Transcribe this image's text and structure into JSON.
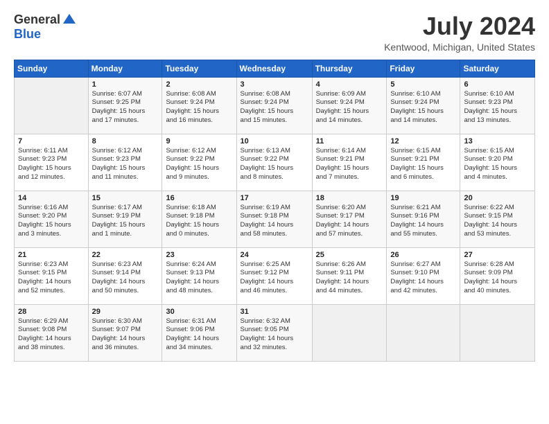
{
  "header": {
    "logo_general": "General",
    "logo_blue": "Blue",
    "month_title": "July 2024",
    "location": "Kentwood, Michigan, United States"
  },
  "weekdays": [
    "Sunday",
    "Monday",
    "Tuesday",
    "Wednesday",
    "Thursday",
    "Friday",
    "Saturday"
  ],
  "weeks": [
    [
      {
        "day": "",
        "info": ""
      },
      {
        "day": "1",
        "info": "Sunrise: 6:07 AM\nSunset: 9:25 PM\nDaylight: 15 hours\nand 17 minutes."
      },
      {
        "day": "2",
        "info": "Sunrise: 6:08 AM\nSunset: 9:24 PM\nDaylight: 15 hours\nand 16 minutes."
      },
      {
        "day": "3",
        "info": "Sunrise: 6:08 AM\nSunset: 9:24 PM\nDaylight: 15 hours\nand 15 minutes."
      },
      {
        "day": "4",
        "info": "Sunrise: 6:09 AM\nSunset: 9:24 PM\nDaylight: 15 hours\nand 14 minutes."
      },
      {
        "day": "5",
        "info": "Sunrise: 6:10 AM\nSunset: 9:24 PM\nDaylight: 15 hours\nand 14 minutes."
      },
      {
        "day": "6",
        "info": "Sunrise: 6:10 AM\nSunset: 9:23 PM\nDaylight: 15 hours\nand 13 minutes."
      }
    ],
    [
      {
        "day": "7",
        "info": "Sunrise: 6:11 AM\nSunset: 9:23 PM\nDaylight: 15 hours\nand 12 minutes."
      },
      {
        "day": "8",
        "info": "Sunrise: 6:12 AM\nSunset: 9:23 PM\nDaylight: 15 hours\nand 11 minutes."
      },
      {
        "day": "9",
        "info": "Sunrise: 6:12 AM\nSunset: 9:22 PM\nDaylight: 15 hours\nand 9 minutes."
      },
      {
        "day": "10",
        "info": "Sunrise: 6:13 AM\nSunset: 9:22 PM\nDaylight: 15 hours\nand 8 minutes."
      },
      {
        "day": "11",
        "info": "Sunrise: 6:14 AM\nSunset: 9:21 PM\nDaylight: 15 hours\nand 7 minutes."
      },
      {
        "day": "12",
        "info": "Sunrise: 6:15 AM\nSunset: 9:21 PM\nDaylight: 15 hours\nand 6 minutes."
      },
      {
        "day": "13",
        "info": "Sunrise: 6:15 AM\nSunset: 9:20 PM\nDaylight: 15 hours\nand 4 minutes."
      }
    ],
    [
      {
        "day": "14",
        "info": "Sunrise: 6:16 AM\nSunset: 9:20 PM\nDaylight: 15 hours\nand 3 minutes."
      },
      {
        "day": "15",
        "info": "Sunrise: 6:17 AM\nSunset: 9:19 PM\nDaylight: 15 hours\nand 1 minute."
      },
      {
        "day": "16",
        "info": "Sunrise: 6:18 AM\nSunset: 9:18 PM\nDaylight: 15 hours\nand 0 minutes."
      },
      {
        "day": "17",
        "info": "Sunrise: 6:19 AM\nSunset: 9:18 PM\nDaylight: 14 hours\nand 58 minutes."
      },
      {
        "day": "18",
        "info": "Sunrise: 6:20 AM\nSunset: 9:17 PM\nDaylight: 14 hours\nand 57 minutes."
      },
      {
        "day": "19",
        "info": "Sunrise: 6:21 AM\nSunset: 9:16 PM\nDaylight: 14 hours\nand 55 minutes."
      },
      {
        "day": "20",
        "info": "Sunrise: 6:22 AM\nSunset: 9:15 PM\nDaylight: 14 hours\nand 53 minutes."
      }
    ],
    [
      {
        "day": "21",
        "info": "Sunrise: 6:23 AM\nSunset: 9:15 PM\nDaylight: 14 hours\nand 52 minutes."
      },
      {
        "day": "22",
        "info": "Sunrise: 6:23 AM\nSunset: 9:14 PM\nDaylight: 14 hours\nand 50 minutes."
      },
      {
        "day": "23",
        "info": "Sunrise: 6:24 AM\nSunset: 9:13 PM\nDaylight: 14 hours\nand 48 minutes."
      },
      {
        "day": "24",
        "info": "Sunrise: 6:25 AM\nSunset: 9:12 PM\nDaylight: 14 hours\nand 46 minutes."
      },
      {
        "day": "25",
        "info": "Sunrise: 6:26 AM\nSunset: 9:11 PM\nDaylight: 14 hours\nand 44 minutes."
      },
      {
        "day": "26",
        "info": "Sunrise: 6:27 AM\nSunset: 9:10 PM\nDaylight: 14 hours\nand 42 minutes."
      },
      {
        "day": "27",
        "info": "Sunrise: 6:28 AM\nSunset: 9:09 PM\nDaylight: 14 hours\nand 40 minutes."
      }
    ],
    [
      {
        "day": "28",
        "info": "Sunrise: 6:29 AM\nSunset: 9:08 PM\nDaylight: 14 hours\nand 38 minutes."
      },
      {
        "day": "29",
        "info": "Sunrise: 6:30 AM\nSunset: 9:07 PM\nDaylight: 14 hours\nand 36 minutes."
      },
      {
        "day": "30",
        "info": "Sunrise: 6:31 AM\nSunset: 9:06 PM\nDaylight: 14 hours\nand 34 minutes."
      },
      {
        "day": "31",
        "info": "Sunrise: 6:32 AM\nSunset: 9:05 PM\nDaylight: 14 hours\nand 32 minutes."
      },
      {
        "day": "",
        "info": ""
      },
      {
        "day": "",
        "info": ""
      },
      {
        "day": "",
        "info": ""
      }
    ]
  ]
}
